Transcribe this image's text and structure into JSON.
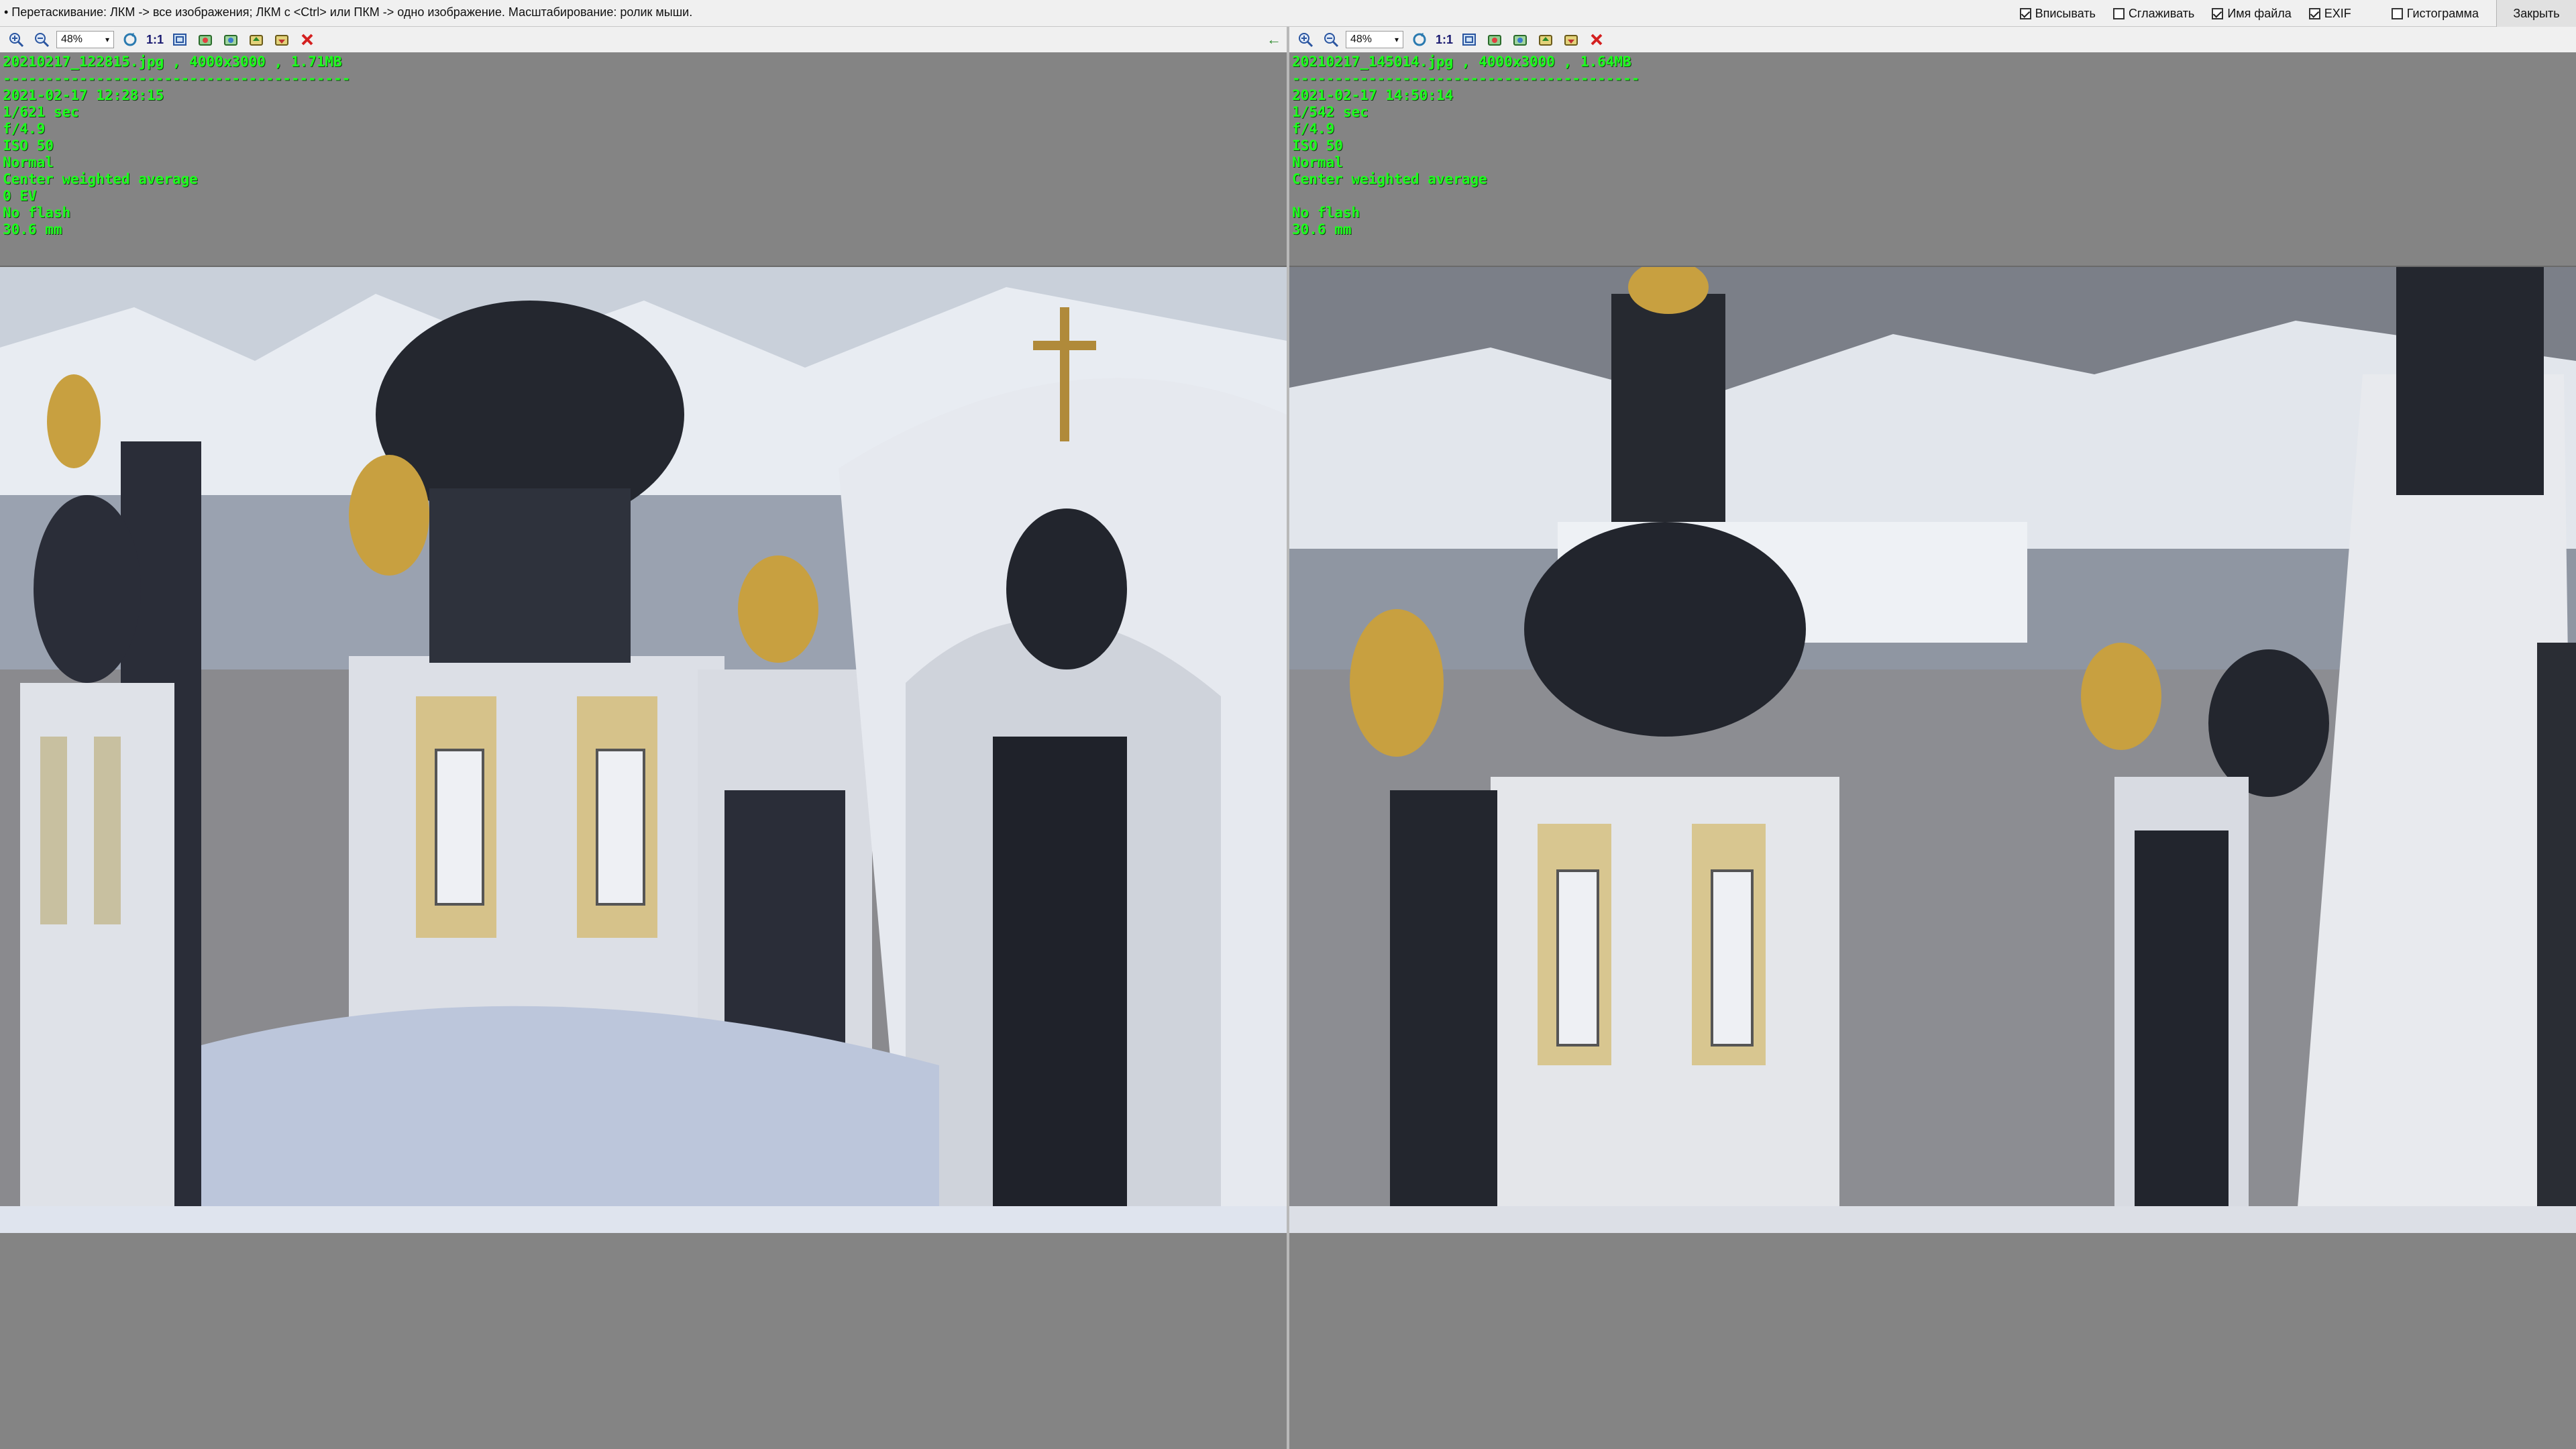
{
  "hint": "• Перетаскивание: ЛКМ -> все изображения; ЛКМ с <Ctrl> или ПКМ -> одно изображение. Масштабирование: ролик мыши.",
  "options": [
    {
      "label": "Вписывать",
      "checked": true
    },
    {
      "label": "Сглаживать",
      "checked": false
    },
    {
      "label": "Имя файла",
      "checked": true
    },
    {
      "label": "EXIF",
      "checked": true
    },
    {
      "label": "Гистограмма",
      "checked": false
    }
  ],
  "close_label": "Закрыть",
  "left": {
    "zoom": "48%",
    "one_to_one": "1:1",
    "file_line": "20210217_122815.jpg , 4000x3000 , 1.71MB",
    "separator": "-----------------------------------------",
    "date": "2021-02-17 12:28:15",
    "shutter": "1/621 sec",
    "aperture": "f/4.9",
    "iso": "ISO 50",
    "mode": "Normal",
    "metering": "Center weighted average",
    "ev": "0 EV",
    "flash": "No flash",
    "focal": "30.6 mm"
  },
  "right": {
    "zoom": "48%",
    "one_to_one": "1:1",
    "file_line": "20210217_145014.jpg , 4000x3000 , 1.64MB",
    "separator": "-----------------------------------------",
    "date": "2021-02-17 14:50:14",
    "shutter": "1/542 sec",
    "aperture": "f/4.9",
    "iso": "ISO 50",
    "mode": "Normal",
    "metering": "Center weighted average",
    "ev": "",
    "flash": "No flash",
    "focal": "30.6 mm"
  },
  "icons": {
    "zoom_in": "zoom-in-icon",
    "zoom_out": "zoom-out-icon",
    "fit": "fit-window-icon",
    "close": "close-icon",
    "back": "arrow-left-icon"
  },
  "colors": {
    "exif_text": "#1cff1c",
    "close_x": "#d42020",
    "pane_bg": "#848484"
  }
}
